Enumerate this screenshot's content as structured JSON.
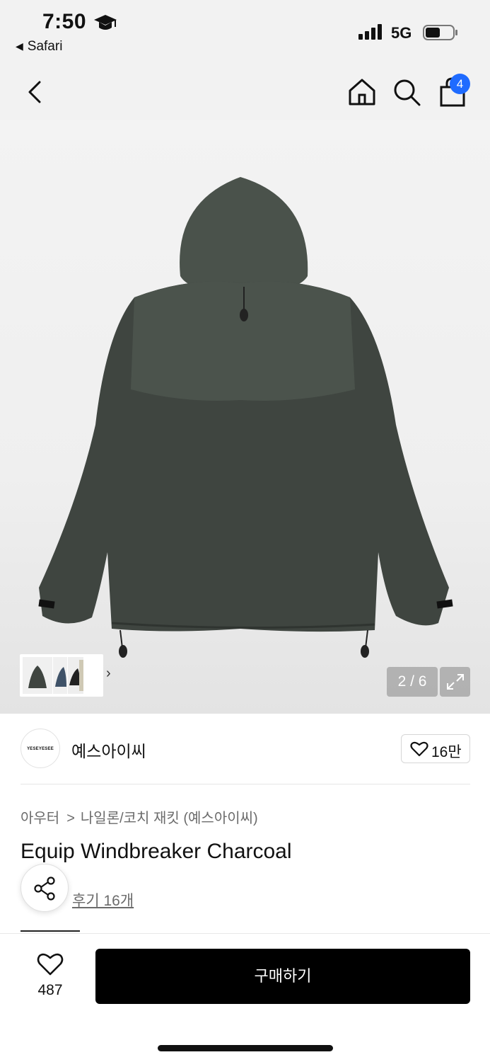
{
  "status_bar": {
    "time": "7:50",
    "back_app": "Safari",
    "network": "5G"
  },
  "nav": {
    "cart_count": "4",
    "icons": [
      "back-icon",
      "home-icon",
      "search-icon",
      "shopping-bag-icon"
    ]
  },
  "gallery": {
    "counter": "2 / 6",
    "thumb_next": "›"
  },
  "brand": {
    "logo_text": "YESEYESEE",
    "name": "예스아이씨",
    "likes": "16만"
  },
  "product": {
    "breadcrumb": [
      "아우터",
      "나일론/코치 재킷 (예스아이씨)"
    ],
    "breadcrumb_sep": ">",
    "title": "Equip Windbreaker Charcoal",
    "review": "후기 16개"
  },
  "bottom_bar": {
    "wish_count": "487",
    "buy_label": "구매하기"
  },
  "colors": {
    "badge": "#1f6bff",
    "buy_button": "#000000",
    "jacket": "#3f4540"
  }
}
